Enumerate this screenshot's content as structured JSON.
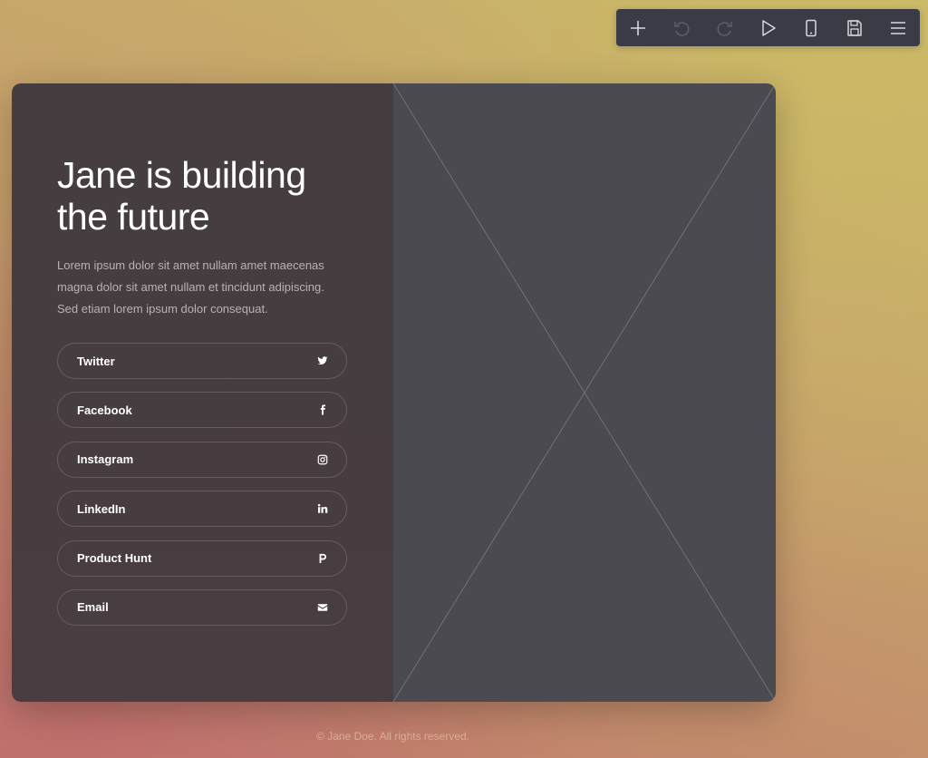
{
  "toolbar": {
    "buttons": [
      {
        "icon": "plus-icon",
        "enabled": true
      },
      {
        "icon": "undo-icon",
        "enabled": false
      },
      {
        "icon": "redo-icon",
        "enabled": false
      },
      {
        "icon": "play-icon",
        "enabled": true
      },
      {
        "icon": "mobile-icon",
        "enabled": true
      },
      {
        "icon": "save-icon",
        "enabled": true
      },
      {
        "icon": "menu-icon",
        "enabled": true
      }
    ]
  },
  "hero": {
    "headline": "Jane is building the future",
    "description": "Lorem ipsum dolor sit amet nullam amet maecenas magna dolor sit amet nullam et tincidunt adipiscing. Sed etiam lorem ipsum dolor consequat."
  },
  "links": [
    {
      "label": "Twitter",
      "icon": "twitter-icon"
    },
    {
      "label": "Facebook",
      "icon": "facebook-icon"
    },
    {
      "label": "Instagram",
      "icon": "instagram-icon"
    },
    {
      "label": "LinkedIn",
      "icon": "linkedin-icon"
    },
    {
      "label": "Product Hunt",
      "icon": "product-hunt-icon"
    },
    {
      "label": "Email",
      "icon": "envelope-icon"
    }
  ],
  "footer": {
    "text": "© Jane Doe. All rights reserved."
  },
  "colors": {
    "panel_left": "#463d40",
    "panel_right": "#4a4a50",
    "toolbar": "#3a3b44"
  }
}
